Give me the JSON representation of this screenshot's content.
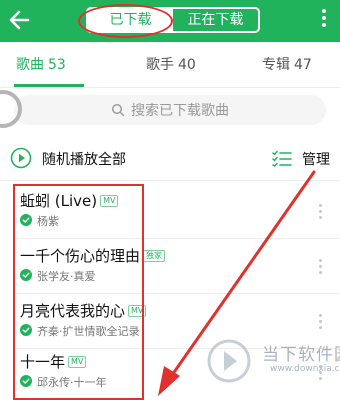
{
  "header": {
    "tabs": [
      {
        "label": "已下载",
        "active": true
      },
      {
        "label": "正在下载",
        "active": false
      }
    ],
    "back_icon": "arrow-left-icon",
    "more_icon": "more-vertical-icon",
    "bg_color": "#21b35c"
  },
  "categories": [
    {
      "label": "歌曲",
      "count": "53",
      "active": true
    },
    {
      "label": "歌手",
      "count": "40",
      "active": false
    },
    {
      "label": "专辑",
      "count": "47",
      "active": false
    }
  ],
  "search": {
    "placeholder": "搜索已下载歌曲"
  },
  "controls": {
    "shuffle_label": "随机播放全部",
    "manage_label": "管理"
  },
  "songs": [
    {
      "title": "蚯蚓 (Live)",
      "badge": "MV",
      "subtitle": "杨紫"
    },
    {
      "title": "一千个伤心的理由",
      "badge": "独家",
      "subtitle": "张学友·真爱"
    },
    {
      "title": "月亮代表我的心",
      "badge": "MV",
      "subtitle": "齐秦·扩世情歌全记录"
    },
    {
      "title": "十一年",
      "badge": "MV",
      "subtitle": "邱永传·十一年"
    }
  ],
  "annotation_color": "#e0312f",
  "watermark": {
    "text": "当下软件园",
    "url": "www.downxia.com"
  }
}
